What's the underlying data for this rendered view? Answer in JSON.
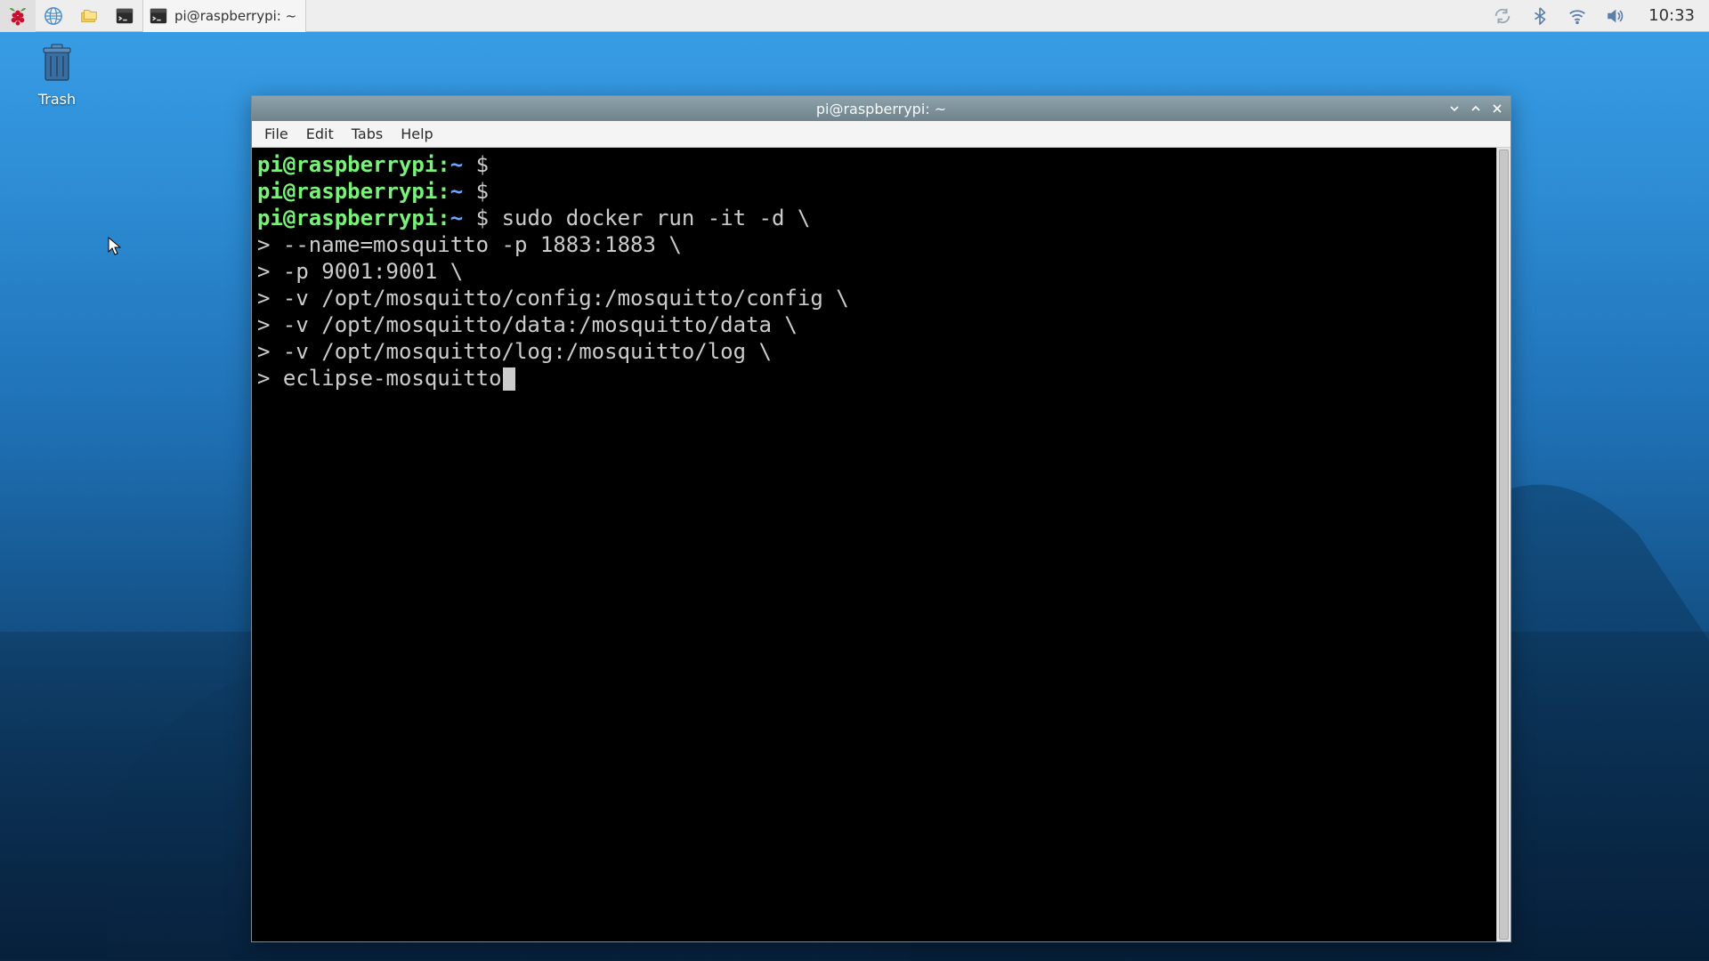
{
  "panel": {
    "taskbar_item_label": "pi@raspberrypi: ~",
    "clock": "10:33"
  },
  "desktop": {
    "trash_label": "Trash"
  },
  "terminal": {
    "title": "pi@raspberrypi: ~",
    "menus": {
      "file": "File",
      "edit": "Edit",
      "tabs": "Tabs",
      "help": "Help"
    },
    "prompt": {
      "user_host": "pi@raspberrypi",
      "separator": ":",
      "path": "~",
      "sigil": "$"
    },
    "continuation_sigil": ">",
    "lines": [
      {
        "type": "prompt",
        "command": ""
      },
      {
        "type": "prompt",
        "command": ""
      },
      {
        "type": "prompt",
        "command": "sudo docker run -it -d \\"
      },
      {
        "type": "continuation",
        "text": "--name=mosquitto -p 1883:1883 \\"
      },
      {
        "type": "continuation",
        "text": "-p 9001:9001 \\"
      },
      {
        "type": "continuation",
        "text": "-v /opt/mosquitto/config:/mosquitto/config \\"
      },
      {
        "type": "continuation",
        "text": "-v /opt/mosquitto/data:/mosquitto/data \\"
      },
      {
        "type": "continuation",
        "text": "-v /opt/mosquitto/log:/mosquitto/log \\"
      },
      {
        "type": "continuation",
        "text": "eclipse-mosquitto",
        "cursor": true
      }
    ]
  },
  "colors": {
    "prompt_user": "#7af27a",
    "prompt_path": "#6aa6ff",
    "terminal_fg": "#cccccc",
    "terminal_bg": "#000000",
    "panel_bg": "#eeeeee"
  }
}
